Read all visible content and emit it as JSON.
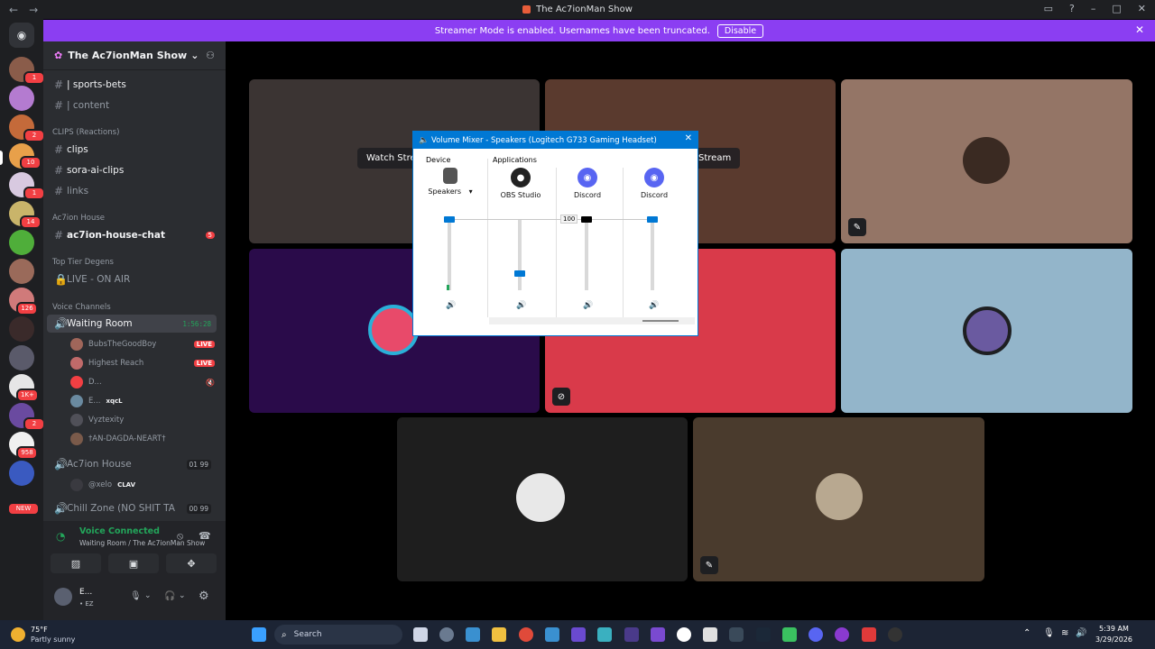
{
  "window": {
    "title": "The Ac7ionMan Show",
    "back": "←",
    "forward": "→"
  },
  "banner": {
    "text": "Streamer Mode is enabled. Usernames have been truncated.",
    "button": "Disable"
  },
  "server_rail": {
    "badges": [
      "1",
      "2",
      "10",
      "1",
      "14",
      "126",
      "1K+",
      "2",
      "958"
    ],
    "new_label": "NEW"
  },
  "server": {
    "name": "The Ac7ionMan Show"
  },
  "channels": {
    "top": [
      {
        "label": "| sports-bets"
      },
      {
        "label": "| content"
      }
    ],
    "clips_category": "CLIPS (Reactions)",
    "clips": [
      {
        "label": "clips"
      },
      {
        "label": "sora-ai-clips"
      },
      {
        "label": "links"
      }
    ],
    "house_category": "Ac7ion House",
    "house_chat": {
      "label": "ac7ion-house-chat",
      "badge": "5"
    },
    "degens_category": "Top Tier Degens",
    "live_on_air": "LIVE - ON AIR",
    "voice_category": "Voice Channels",
    "waiting_room": {
      "label": "Waiting Room",
      "timer": "1:56:28"
    },
    "waiting_users": [
      {
        "name": "BubsTheGoodBoy",
        "live": "LIVE"
      },
      {
        "name": "Highest Reach",
        "live": "LIVE"
      },
      {
        "name": "D..."
      },
      {
        "name": "E...",
        "tag": "xqcL"
      },
      {
        "name": "Vyztexity"
      },
      {
        "name": "†AN-DAGDA-NEART†"
      }
    ],
    "action_house": {
      "label": "Ac7ion House",
      "count_a": "01",
      "count_b": "99"
    },
    "action_house_users": [
      {
        "name": "@xelo",
        "tag": "CLAV"
      }
    ],
    "chill_zone": {
      "label": "Chill Zone (NO SHIT TA...",
      "count_a": "00",
      "count_b": "99"
    }
  },
  "voice_panel": {
    "status": "Voice Connected",
    "subtitle": "Waiting Room / The Ac7ionMan Show"
  },
  "user_panel": {
    "name": "E...",
    "status": "• EZ"
  },
  "stream_tiles": {
    "watch_label": "Watch Stream",
    "watch_label_right": "Stream"
  },
  "mixer": {
    "title": "Volume Mixer - Speakers (Logitech G733 Gaming Headset)",
    "device_header": "Device",
    "apps_header": "Applications",
    "columns": [
      {
        "label": "Speakers",
        "icon": "speaker-device-icon",
        "level": 1.0
      },
      {
        "label": "OBS Studio",
        "icon": "obs-icon",
        "level": 0.2
      },
      {
        "label": "Discord",
        "icon": "discord-icon",
        "level": 1.0
      },
      {
        "label": "Discord",
        "icon": "discord-icon",
        "level": 1.0
      }
    ],
    "tooltip": "100"
  },
  "taskbar": {
    "weather_temp": "75°F",
    "weather_desc": "Partly sunny",
    "search": "Search",
    "time": "5:39 AM",
    "date": "3/29/2026"
  },
  "colors": {
    "accent": "#5865f2",
    "banner": "#8b3ef2",
    "green": "#23a55a",
    "red": "#f23f43",
    "windows_blue": "#0078d4"
  }
}
